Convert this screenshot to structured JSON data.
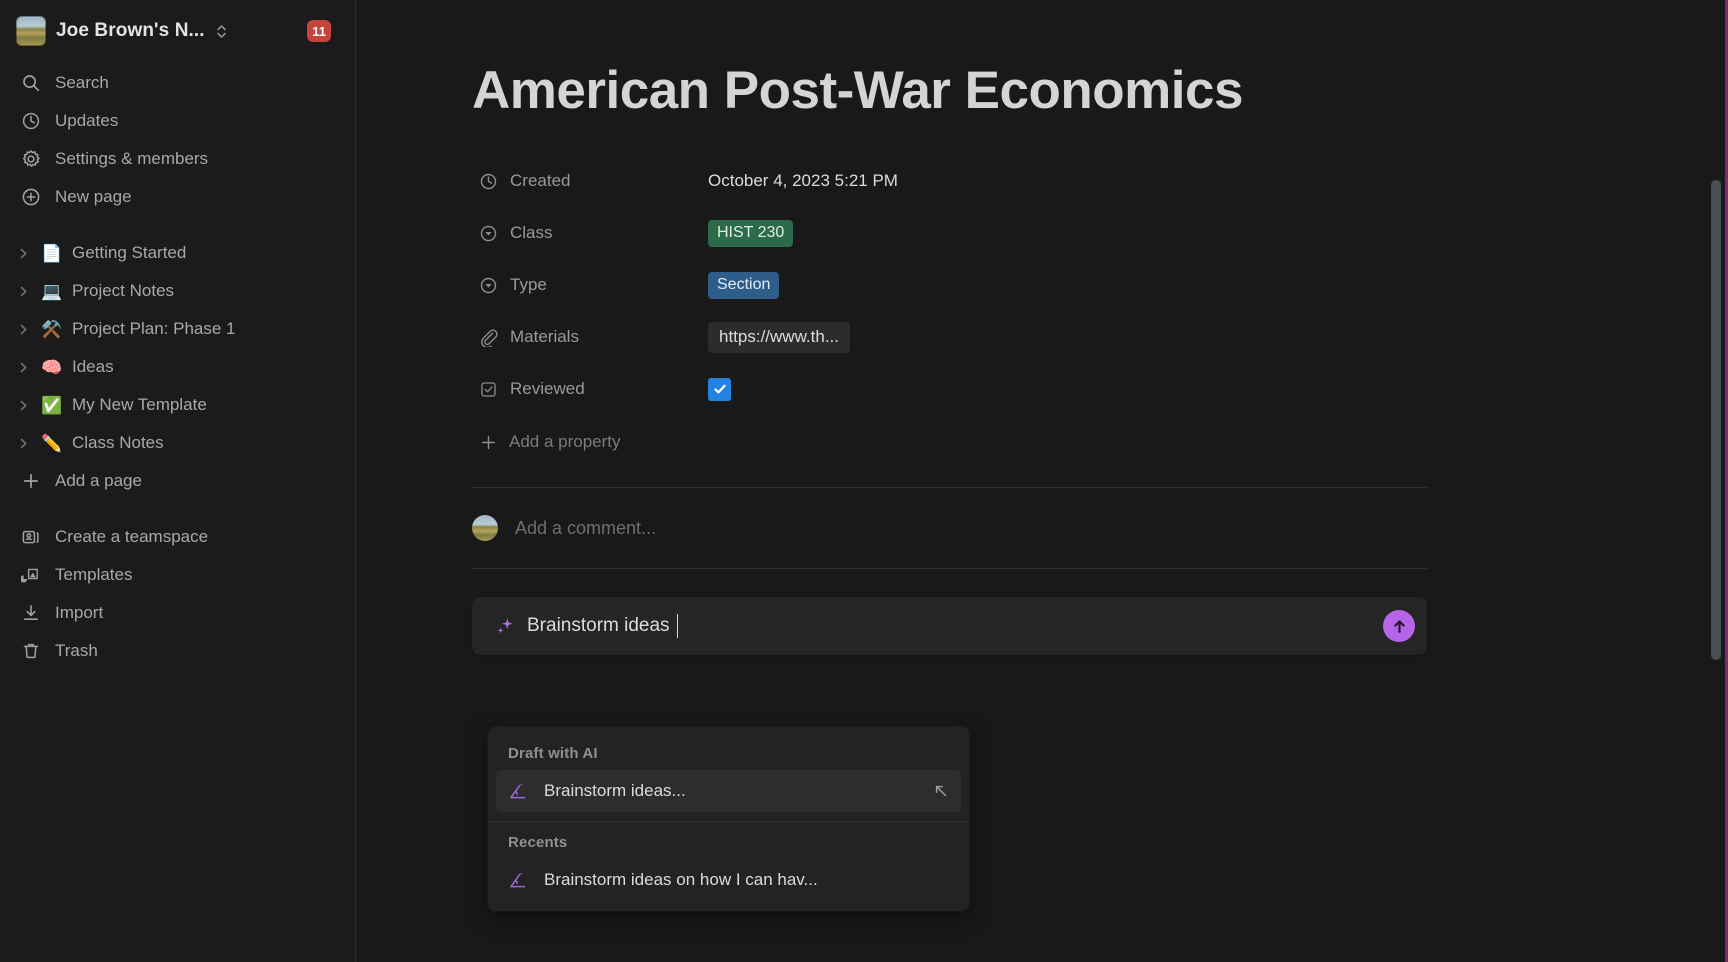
{
  "sidebar": {
    "workspace": {
      "name": "Joe Brown's N...",
      "badge_count": "11"
    },
    "nav": [
      {
        "label": "Search",
        "icon": "search-icon"
      },
      {
        "label": "Updates",
        "icon": "clock-icon"
      },
      {
        "label": "Settings & members",
        "icon": "gear-icon"
      },
      {
        "label": "New page",
        "icon": "plus-circle-icon"
      }
    ],
    "pages": [
      {
        "label": "Getting Started",
        "emoji": "📄"
      },
      {
        "label": "Project Notes",
        "emoji": "💻"
      },
      {
        "label": "Project Plan: Phase 1",
        "emoji": "⚒️"
      },
      {
        "label": "Ideas",
        "emoji": "🧠"
      },
      {
        "label": "My New Template",
        "emoji": "✅"
      },
      {
        "label": "Class Notes",
        "emoji": "✏️"
      }
    ],
    "add_page": {
      "label": "Add a page",
      "icon": "plus-icon"
    },
    "bottom": [
      {
        "label": "Create a teamspace",
        "icon": "teamspace-icon"
      },
      {
        "label": "Templates",
        "icon": "templates-icon"
      },
      {
        "label": "Import",
        "icon": "import-icon"
      },
      {
        "label": "Trash",
        "icon": "trash-icon"
      }
    ]
  },
  "page": {
    "title": "American Post-War Economics",
    "properties": [
      {
        "key": "Created",
        "icon": "clock-icon",
        "type": "text",
        "value": "October 4, 2023 5:21 PM"
      },
      {
        "key": "Class",
        "icon": "select-icon",
        "type": "chip",
        "value": "HIST 230",
        "color": "#2d6a4a"
      },
      {
        "key": "Type",
        "icon": "select-icon",
        "type": "chip",
        "value": "Section",
        "color": "#2f5d8a"
      },
      {
        "key": "Materials",
        "icon": "paperclip-icon",
        "type": "url",
        "value": "https://www.th..."
      },
      {
        "key": "Reviewed",
        "icon": "checkbox-icon",
        "type": "checkbox",
        "value": "checked",
        "color": "#2383e2"
      }
    ],
    "add_property_label": "Add a property",
    "comment_placeholder": "Add a comment..."
  },
  "ai_bar": {
    "input_value": "Brainstorm ideas",
    "spark_icon": "sparkle-icon",
    "send_icon": "arrow-up-icon",
    "send_color": "#b765e8"
  },
  "ai_menu": {
    "sections": [
      {
        "title": "Draft with AI",
        "items": [
          {
            "label": "Brainstorm ideas...",
            "icon": "ai-pen-icon",
            "active": true,
            "shortcut_icon": "enter-arrow-icon"
          }
        ]
      },
      {
        "title": "Recents",
        "items": [
          {
            "label": "Brainstorm ideas on how I can hav...",
            "icon": "ai-pen-icon",
            "active": false
          }
        ]
      }
    ]
  }
}
